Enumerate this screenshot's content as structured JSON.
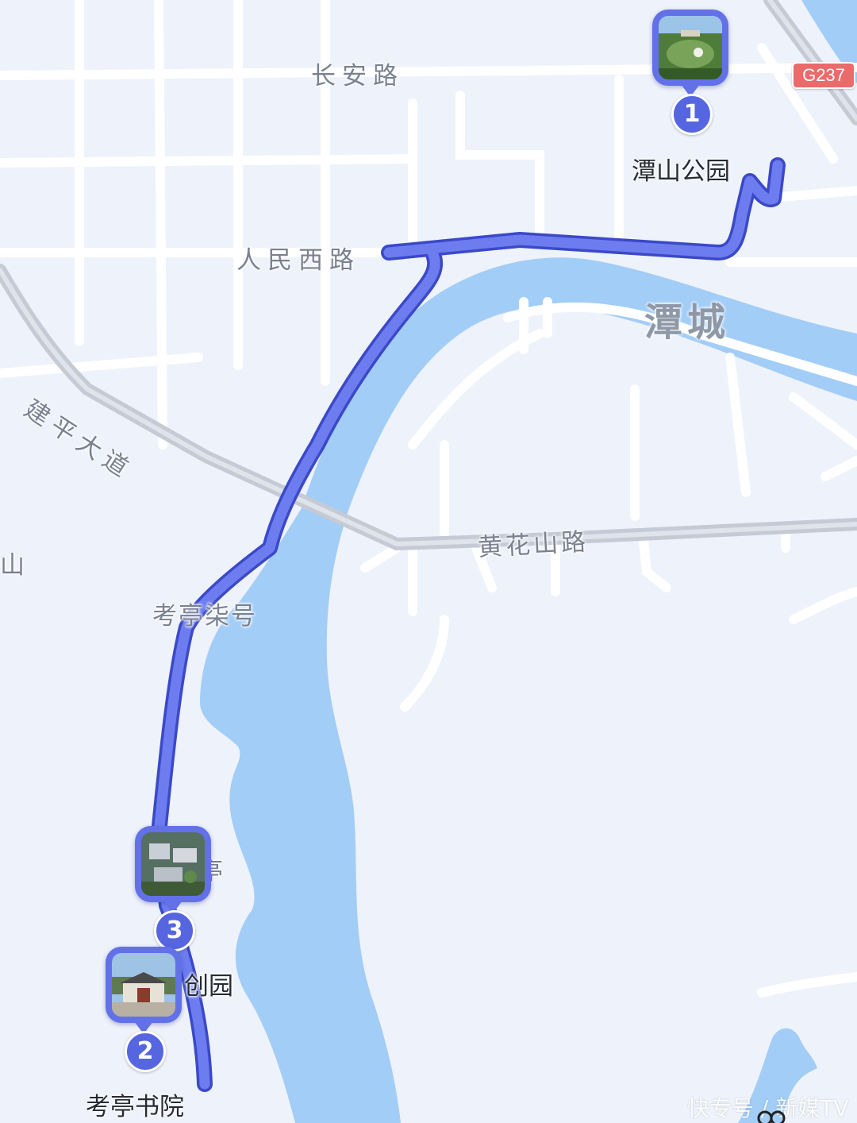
{
  "map": {
    "road_labels": {
      "changan": "长安路",
      "renmin_west": "人民西路",
      "jianping": "建平大道",
      "huanghuashan": "黄花山路",
      "kaoting": "考亭柒号",
      "edge_fragment": "山",
      "partial_fragment": "亭"
    },
    "district": "潭城",
    "highway_badge": "G237",
    "markers": [
      {
        "order": "1",
        "name": "潭山公园"
      },
      {
        "order": "2",
        "name": "考亭书院"
      },
      {
        "order": "3",
        "name": "文创园",
        "name_visible": "创园"
      }
    ],
    "watermark": "快专号 / 新媒TV",
    "colors": {
      "route": "#6271e8",
      "route_outline": "#3b49c8",
      "water": "#a2cdf7",
      "land": "#eef2fa",
      "road": "#ffffff",
      "arterial": "#c5cad5",
      "marker": "#6271e8",
      "highway_badge": "#eb6a6a"
    }
  }
}
